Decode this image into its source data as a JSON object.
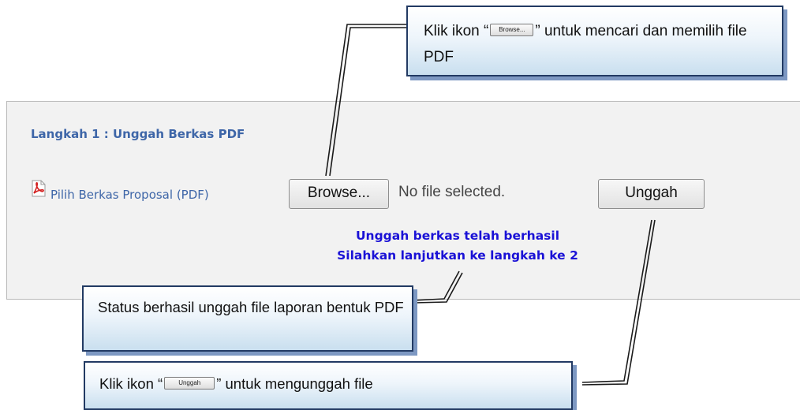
{
  "panel": {
    "step_title": "Langkah 1 : Unggah Berkas PDF",
    "pick_label": "Pilih Berkas Proposal (PDF)",
    "browse_label": "Browse...",
    "no_file_text": "No file selected.",
    "unggah_label": "Unggah",
    "status_line1": "Unggah berkas telah berhasil",
    "status_line2": "Silahkan lanjutkan ke langkah ke 2"
  },
  "callouts": {
    "top": {
      "prefix": "Klik ikon “",
      "button": "Browse...",
      "suffix": "” untuk mencari dan memilih file PDF"
    },
    "status": {
      "text": "Status berhasil unggah file laporan bentuk PDF"
    },
    "bottom": {
      "prefix": "Klik ikon “",
      "button": "Unggah",
      "suffix": "” untuk mengunggah file"
    }
  },
  "colors": {
    "title_blue": "#3e66a8",
    "status_blue": "#1a11d6",
    "callout_border": "#223a63"
  },
  "icons": {
    "pdf": "pdf-file-icon"
  }
}
